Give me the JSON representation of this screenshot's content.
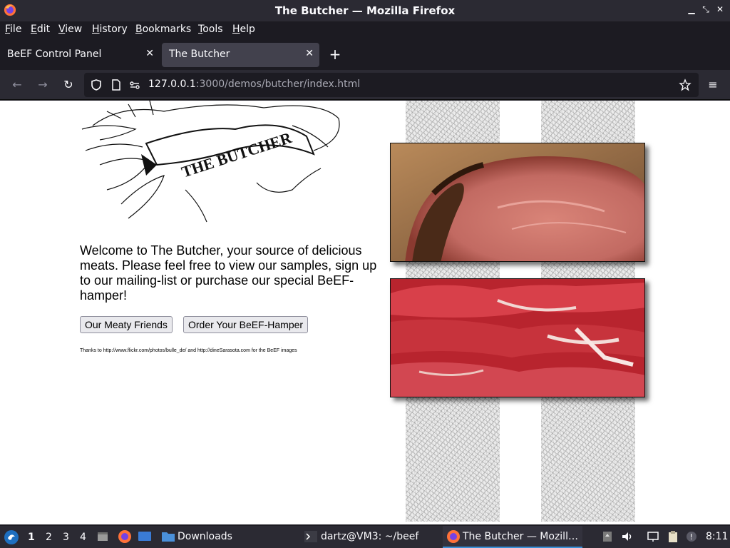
{
  "window": {
    "title": "The Butcher — Mozilla Firefox",
    "controls": [
      "minimize-icon",
      "maximize-icon",
      "close-icon"
    ]
  },
  "menu": {
    "items": [
      "File",
      "Edit",
      "View",
      "History",
      "Bookmarks",
      "Tools",
      "Help"
    ]
  },
  "tabs": [
    {
      "label": "BeEF Control Panel",
      "active": false
    },
    {
      "label": "The Butcher",
      "active": true
    }
  ],
  "navbar": {
    "url_host": "127.0.0.1",
    "url_rest": ":3000/demos/butcher/index.html"
  },
  "page": {
    "logo_text": "THE BUTCHER",
    "welcome": "Welcome to The Butcher, your source of delicious meats. Please feel free to view our samples, sign up to our mailing-list or purchase our special BeEF-hamper!",
    "buttons": [
      "Our Meaty Friends",
      "Order Your BeEF-Hamper"
    ],
    "credits": "Thanks to http://www.flickr.com/photos/bulle_de/ and http://dineSarasota.com for the BeEF images"
  },
  "taskbar": {
    "workspaces": [
      "1",
      "2",
      "3",
      "4"
    ],
    "active_workspace": "1",
    "items": [
      {
        "label": "Downloads",
        "icon": "folder-icon"
      },
      {
        "label": "dartz@VM3: ~/beef",
        "icon": "terminal-icon"
      },
      {
        "label": "The Butcher — Mozill…",
        "icon": "firefox-icon",
        "active": true
      }
    ],
    "clock": "8:11"
  },
  "colors": {
    "chrome_dark": "#1c1b22",
    "chrome": "#2b2a33",
    "active_tab": "#42414d",
    "accent": "#3a8fd6"
  }
}
